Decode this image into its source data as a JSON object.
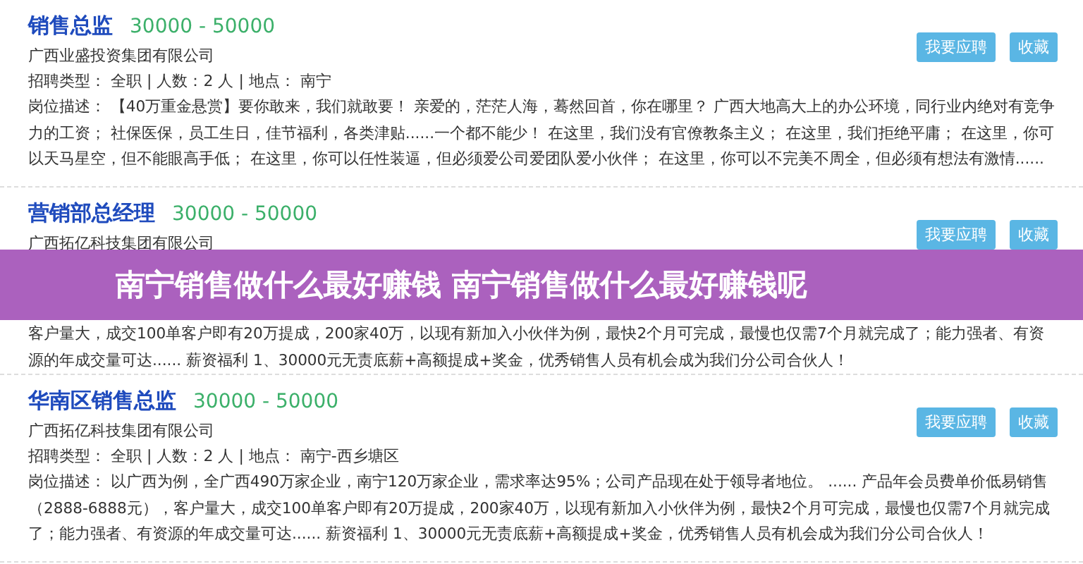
{
  "jobs": [
    {
      "title": "销售总监",
      "salary": "30000 - 50000",
      "company": "广西业盛投资集团有限公司",
      "meta": "招聘类型： 全职 | 人数：2 人 | 地点： 南宁",
      "description": "岗位描述： 【40万重金悬赏】要你敢来，我们就敢要！ 亲爱的，茫茫人海，蓦然回首，你在哪里？ 广西大地高大上的办公环境，同行业内绝对有竞争力的工资； 社保医保，员工生日，佳节福利，各类津贴......一个都不能少！ 在这里，我们没有官僚教条主义； 在这里，我们拒绝平庸； 在这里，你可以天马星空，但不能眼高手低； 在这里，你可以任性装逼，但必须爱公司爱团队爱小伙伴； 在这里，你可以不完美不周全，但必须有想法有激情......",
      "buttons": [
        "我要应聘",
        "收藏"
      ]
    },
    {
      "title": "营销部总经理",
      "salary": "30000 - 50000",
      "company": "广西拓亿科技集团有限公司",
      "description": "客户量大，成交100单客户即有20万提成，200家40万，以现有新加入小伙伴为例，最快2个月可完成，最慢也仅需7个月就完成了；能力强者、有资源的年成交量可达...... 薪资福利 1、30000元无责底薪+高额提成+奖金，优秀销售人员有机会成为我们分公司合伙人！",
      "buttons": [
        "我要应聘",
        "收藏"
      ]
    },
    {
      "title": "华南区销售总监",
      "salary": "30000 - 50000",
      "company": "广西拓亿科技集团有限公司",
      "meta": "招聘类型： 全职 | 人数：2 人 | 地点： 南宁-西乡塘区",
      "description": "岗位描述： 以广西为例，全广西490万家企业，南宁120万家企业，需求率达95%；公司产品现在处于领导者地位。 ...... 产品年会员费单价低易销售（2888-6888元），客户量大，成交100单客户即有20万提成，200家40万，以现有新加入小伙伴为例，最快2个月可完成，最慢也仅需7个月就完成了；能力强者、有资源的年成交量可达...... 薪资福利 1、30000元无责底薪+高额提成+奖金，优秀销售人员有机会成为我们分公司合伙人！",
      "buttons": [
        "我要应聘",
        "收藏"
      ]
    }
  ],
  "banner": {
    "title": "南宁销售做什么最好赚钱 南宁销售做什么最好赚钱呢"
  }
}
